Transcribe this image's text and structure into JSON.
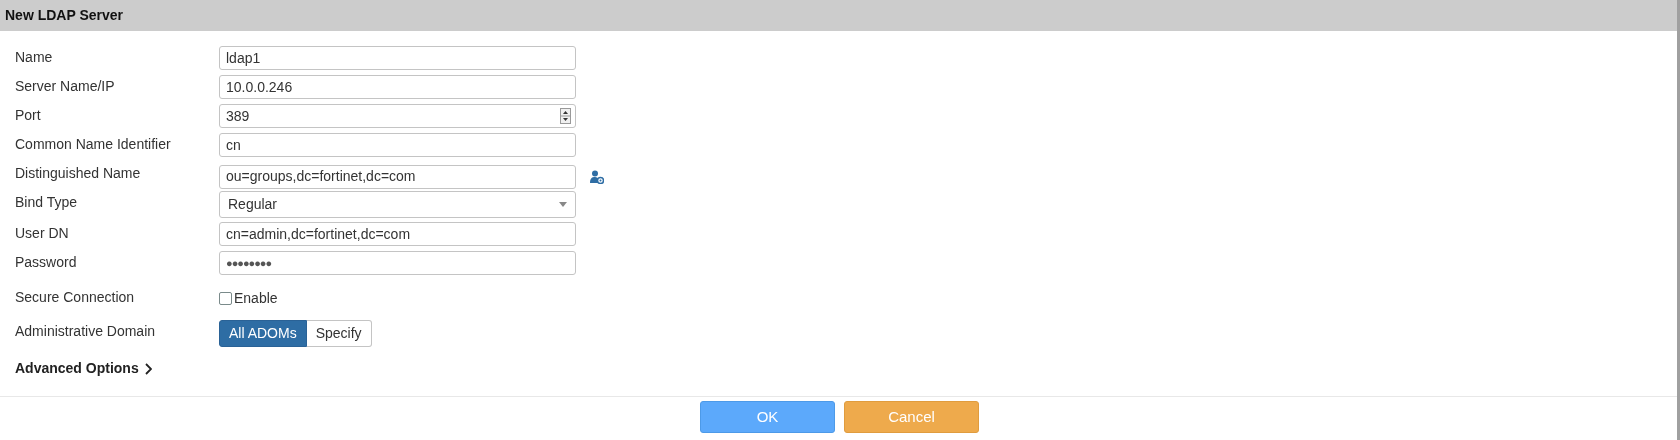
{
  "window": {
    "title": "New LDAP Server"
  },
  "fields": [
    {
      "kind": "text",
      "label": "Name",
      "value": "ldap1"
    },
    {
      "kind": "text",
      "label": "Server Name/IP",
      "value": "10.0.0.246"
    },
    {
      "kind": "number",
      "label": "Port",
      "value": "389"
    },
    {
      "kind": "text",
      "label": "Common Name Identifier",
      "value": "cn"
    },
    {
      "kind": "browse",
      "label": "Distinguished Name",
      "value": "ou=groups,dc=fortinet,dc=com"
    },
    {
      "kind": "select",
      "label": "Bind Type",
      "value": "Regular"
    },
    {
      "kind": "text",
      "label": "User DN",
      "value": "cn=admin,dc=fortinet,dc=com"
    },
    {
      "kind": "password",
      "label": "Password",
      "value": "●●●●●●●●"
    },
    {
      "kind": "checkbox",
      "label": "Secure Connection",
      "option": "Enable",
      "checked": false
    },
    {
      "kind": "segmented",
      "label": "Administrative Domain",
      "options": [
        {
          "label": "All ADOMs",
          "selected": true
        },
        {
          "label": "Specify",
          "selected": false
        }
      ]
    }
  ],
  "advanced_options": {
    "label": "Advanced Options",
    "expanded": false
  },
  "buttons": [
    {
      "label": "OK",
      "kind": "primary"
    },
    {
      "label": "Cancel",
      "kind": "cancel"
    }
  ]
}
